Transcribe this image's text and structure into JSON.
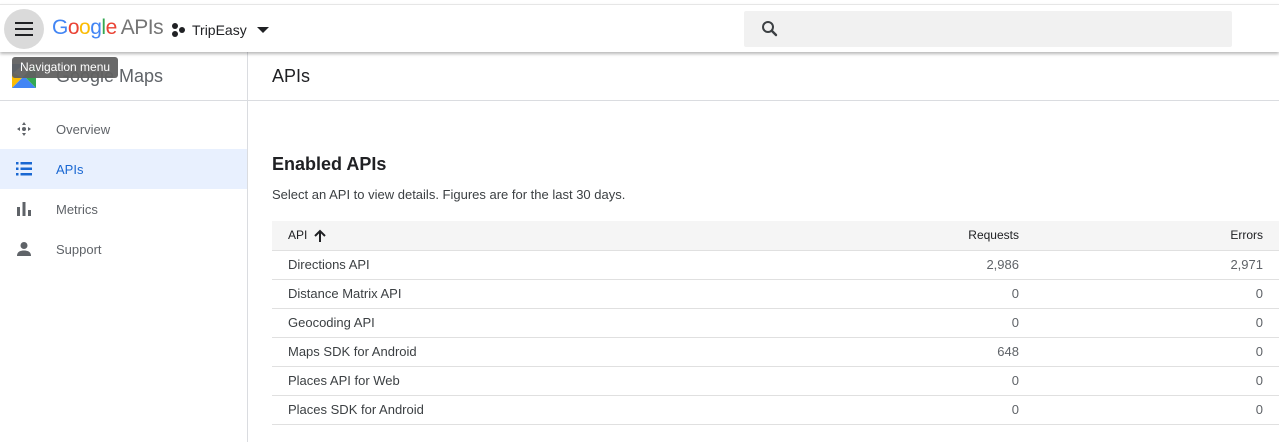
{
  "header": {
    "logo_letters": [
      "G",
      "o",
      "o",
      "g",
      "l",
      "e"
    ],
    "logo_suffix": "APIs",
    "project_name": "TripEasy",
    "search_placeholder": ""
  },
  "tooltip": {
    "text": "Navigation menu"
  },
  "sidebar": {
    "title": "Google Maps",
    "items": [
      {
        "label": "Overview",
        "icon": "overview-icon",
        "active": false
      },
      {
        "label": "APIs",
        "icon": "list-icon",
        "active": true
      },
      {
        "label": "Metrics",
        "icon": "bar-chart-icon",
        "active": false
      },
      {
        "label": "Support",
        "icon": "person-icon",
        "active": false
      }
    ]
  },
  "main": {
    "page_title": "APIs",
    "section_title": "Enabled APIs",
    "section_subtitle": "Select an API to view details. Figures are for the last 30 days.",
    "table": {
      "columns": [
        "API",
        "Requests",
        "Errors"
      ],
      "sort": {
        "column": "API",
        "direction": "ascending"
      },
      "rows": [
        {
          "api": "Directions API",
          "requests": "2,986",
          "errors": "2,971"
        },
        {
          "api": "Distance Matrix API",
          "requests": "0",
          "errors": "0"
        },
        {
          "api": "Geocoding API",
          "requests": "0",
          "errors": "0"
        },
        {
          "api": "Maps SDK for Android",
          "requests": "648",
          "errors": "0"
        },
        {
          "api": "Places API for Web",
          "requests": "0",
          "errors": "0"
        },
        {
          "api": "Places SDK for Android",
          "requests": "0",
          "errors": "0"
        }
      ]
    }
  },
  "colors": {
    "accent": "#1967d2",
    "active_bg": "#e8f0fe",
    "menu_button_bg": "#dadada",
    "tooltip_bg": "#616161",
    "header_row_bg": "#f5f5f5"
  }
}
